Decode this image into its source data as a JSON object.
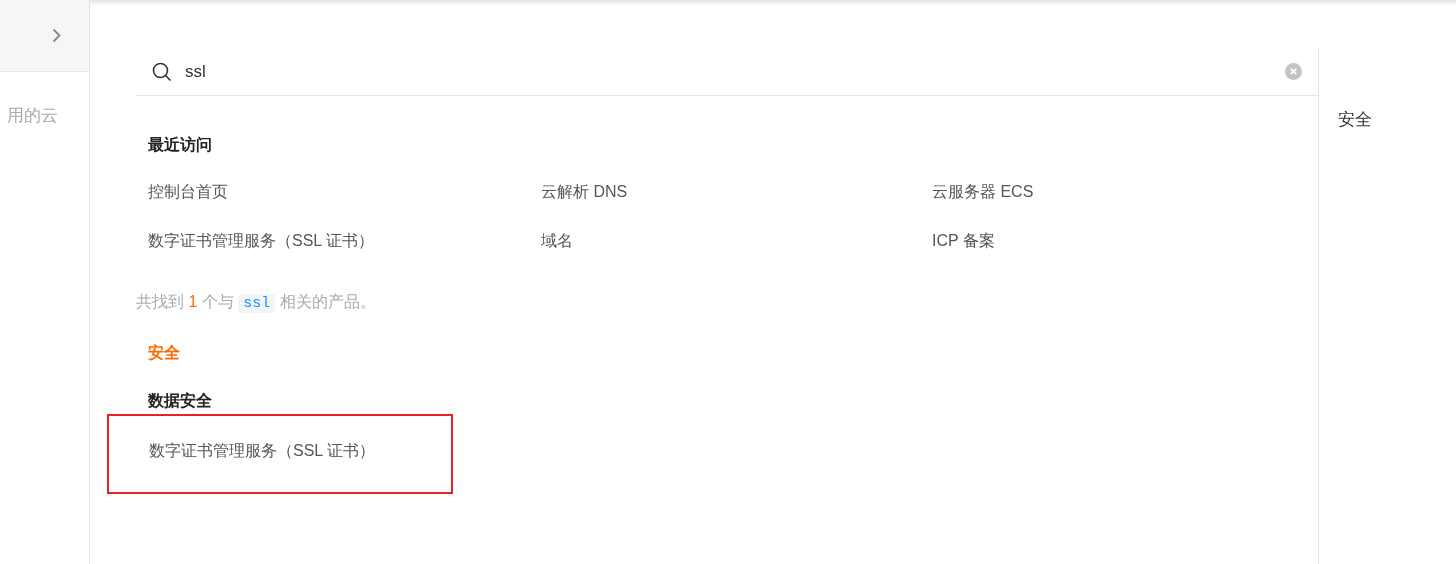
{
  "sidebar": {
    "text": "用的云"
  },
  "search": {
    "value": "ssl"
  },
  "recent": {
    "title": "最近访问",
    "items": [
      {
        "label": "控制台首页"
      },
      {
        "label": "云解析 DNS"
      },
      {
        "label": "云服务器 ECS"
      },
      {
        "label": "数字证书管理服务（SSL 证书）"
      },
      {
        "label": "域名"
      },
      {
        "label": "ICP 备案"
      }
    ]
  },
  "summary": {
    "prefix": "共找到",
    "count": "1",
    "middle": "个与",
    "keyword": "ssl",
    "suffix": "相关的产品。"
  },
  "results": [
    {
      "category": "安全",
      "groups": [
        {
          "title": "数据安全",
          "items": [
            {
              "label": "数字证书管理服务（SSL 证书）",
              "highlighted": true
            }
          ]
        }
      ]
    }
  ],
  "side_nav": [
    {
      "label": "安全"
    }
  ]
}
